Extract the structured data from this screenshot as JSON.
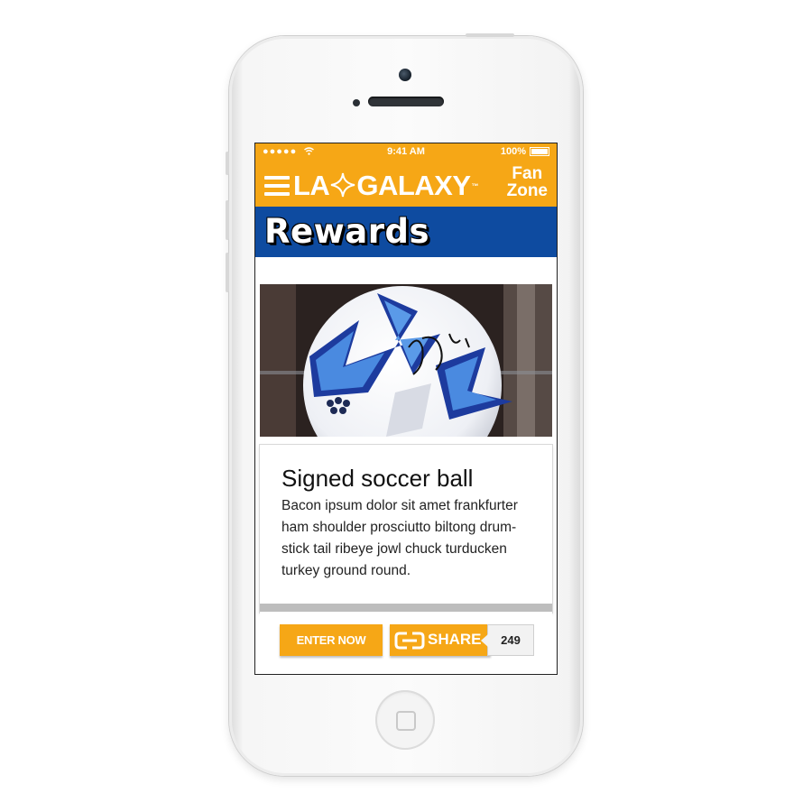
{
  "status_bar": {
    "signal": "●●●●●",
    "time": "9:41 AM",
    "battery_text": "100%"
  },
  "header": {
    "menu_icon": "hamburger-icon",
    "logo_left": "LA",
    "logo_right": "GALAXY",
    "logo_tm": "™",
    "fan_line1": "Fan",
    "fan_line2": "Zone"
  },
  "page": {
    "title": "Rewards"
  },
  "reward": {
    "image_icon": "signed-soccer-ball-photo",
    "title": "Signed soccer ball",
    "description": "Bacon ipsum dolor sit amet frankfurter ham shoulder prosciutto biltong drum-stick tail ribeye jowl chuck turducken turkey ground round."
  },
  "actions": {
    "enter_label": "ENTER NOW",
    "share_label": "SHARE",
    "share_count": "249"
  },
  "colors": {
    "brand_gold": "#f6a716",
    "brand_blue": "#0e4ba0"
  }
}
